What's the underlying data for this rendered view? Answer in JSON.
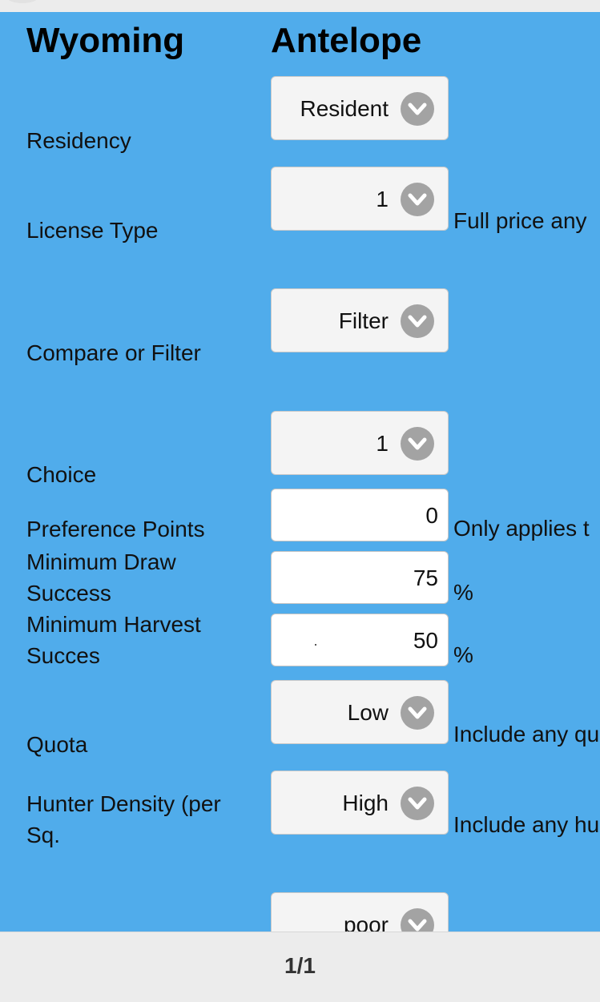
{
  "header": {
    "state": "Wyoming",
    "species": "Antelope"
  },
  "form": {
    "residency": {
      "label": "Residency",
      "value": "Resident"
    },
    "license_type": {
      "label": "License Type",
      "value": "1",
      "note": "Full price any"
    },
    "compare_filter": {
      "label": "Compare or Filter",
      "value": "Filter"
    },
    "choice": {
      "label": "Choice",
      "value": "1"
    },
    "preference_points": {
      "label": "Preference Points",
      "value": "0",
      "note": "Only applies t"
    },
    "min_draw": {
      "label_line1": "Minimum Draw",
      "label_line2": "Success",
      "value": "75",
      "unit": "%"
    },
    "min_harvest": {
      "label_line1": "Minimum Harvest",
      "label_line2": "Succes",
      "value": "50",
      "unit": "%"
    },
    "quota": {
      "label": "Quota",
      "value": "Low",
      "note": "Include any qu"
    },
    "hunter_density": {
      "label_line1": "Hunter Density (per",
      "label_line2": "Sq.",
      "value": "High",
      "note": "Include any hu"
    },
    "last": {
      "value": "poor"
    }
  },
  "footer": {
    "page": "1/1"
  },
  "colors": {
    "panel": "#50aceb",
    "chevron": "#a3a3a3"
  },
  "icons": {
    "dropdown": "chevron-down-icon"
  }
}
